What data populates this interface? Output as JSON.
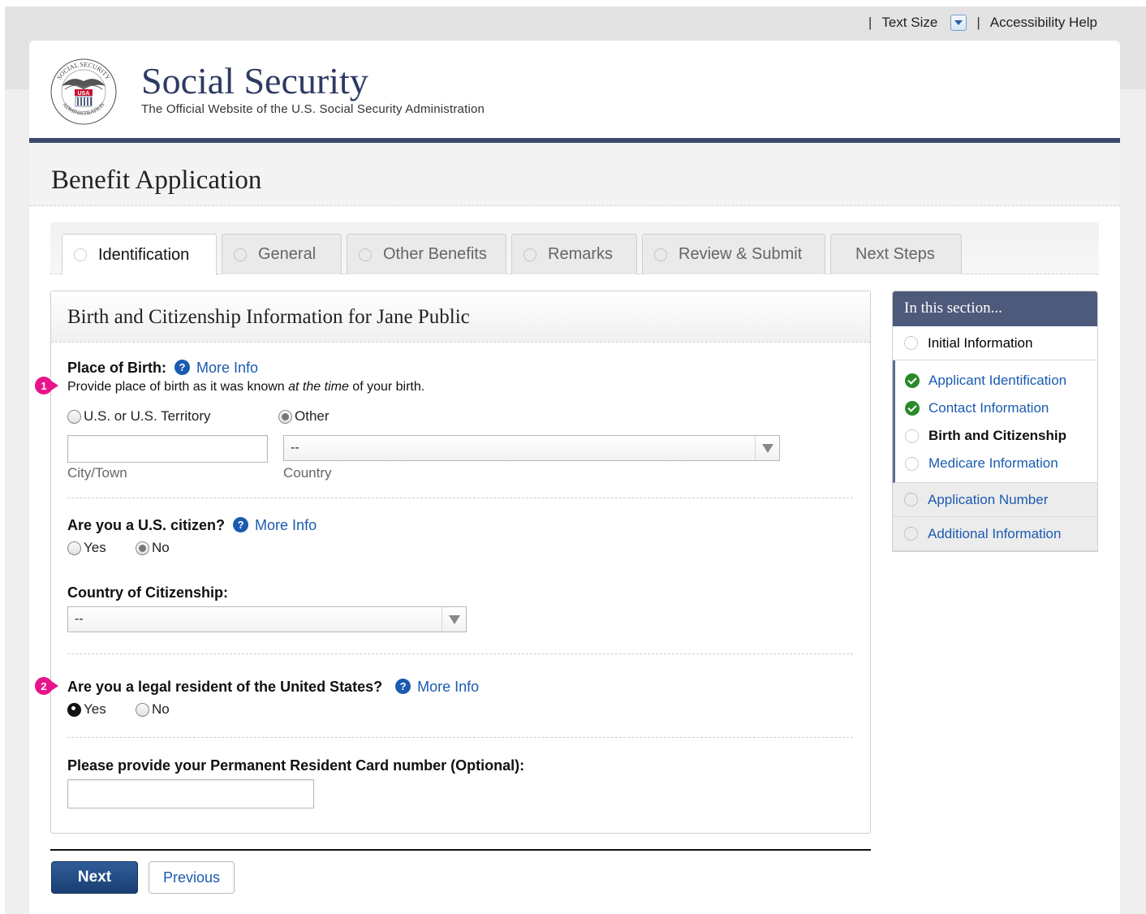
{
  "utility": {
    "sep": "|",
    "text_size": "Text Size",
    "accessibility_help": "Accessibility Help"
  },
  "header": {
    "title": "Social Security",
    "subtitle": "The Official Website of the U.S. Social Security Administration",
    "seal_text_top": "SOCIAL SECURITY",
    "seal_text_bottom": "ADMINISTRATION",
    "seal_usa": "USA"
  },
  "page_title": "Benefit Application",
  "tabs": [
    {
      "label": "Identification"
    },
    {
      "label": "General"
    },
    {
      "label": "Other Benefits"
    },
    {
      "label": "Remarks"
    },
    {
      "label": "Review & Submit"
    },
    {
      "label": "Next Steps"
    }
  ],
  "form": {
    "heading": "Birth and Citizenship Information for Jane Public",
    "more_info": "More Info",
    "place_of_birth": {
      "label": "Place of Birth:",
      "hint_before": "Provide place of birth as it was known ",
      "hint_em": "at the time",
      "hint_after": " of your birth.",
      "option_us": "U.S. or U.S. Territory",
      "option_other": "Other",
      "city_label": "City/Town",
      "city_value": "",
      "country_label": "Country",
      "country_value": "--"
    },
    "citizen": {
      "label": "Are you a U.S. citizen?",
      "yes": "Yes",
      "no": "No"
    },
    "country_citizenship": {
      "label": "Country of Citizenship:",
      "value": "--"
    },
    "legal_resident": {
      "label": "Are you a legal resident of the United States?",
      "yes": "Yes",
      "no": "No"
    },
    "resident_card": {
      "label": "Please provide your Permanent Resident Card number (Optional):",
      "value": ""
    },
    "markers": [
      "1",
      "2"
    ]
  },
  "sidebar": {
    "heading": "In this section...",
    "initial": "Initial Information",
    "subs": [
      {
        "label": "Applicant Identification",
        "state": "done"
      },
      {
        "label": "Contact Information",
        "state": "done"
      },
      {
        "label": "Birth and Citizenship",
        "state": "current"
      },
      {
        "label": "Medicare Information",
        "state": "todo"
      }
    ],
    "application_number": "Application Number",
    "additional_information": "Additional Information"
  },
  "buttons": {
    "next": "Next",
    "previous": "Previous"
  },
  "colors": {
    "brand_navy": "#2d3a63",
    "link_blue": "#1a5bb0",
    "marker_pink": "#e8138c",
    "check_green": "#2a8a2a"
  }
}
